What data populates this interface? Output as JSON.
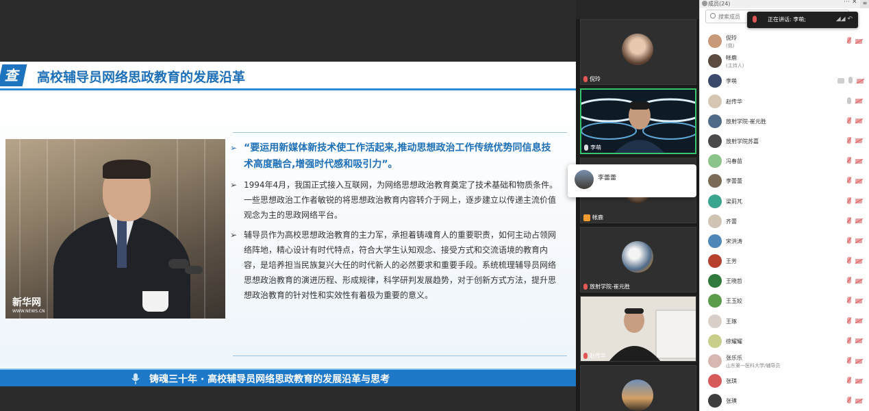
{
  "slide": {
    "logo_glyph": "查",
    "title": "高校辅导员网络思政教育的发展沿革",
    "photo_watermark": "新华网",
    "photo_watermark_sub": "WWW.NEWS.CN",
    "bullets": [
      "“要运用新媒体新技术使工作活起来,推动思想政治工作传统优势同信息技术高度融合,增强时代感和吸引力”。",
      "1994年4月，我国正式接入互联网，为网络思想政治教育奠定了技术基础和物质条件。一些思想政治工作者敏锐的将思想政治教育内容转介于网上，逐步建立以传递主流价值观念为主的思政网络平台。",
      "辅导员作为高校思想政治教育的主力军，承担着铸魂育人的重要职责，如何主动占领网络阵地，精心设计有时代特点，符合大学生认知观念、接受方式和交流语境的教育内容，是培养担当民族复兴大任的时代新人的必然要求和重要手段。系统梳理辅导员网络思想政治教育的演进历程、形成规律，科学研判发展趋势，对于创新方式方法，提升思想政治教育的针对性和实效性有着极为重要的意义。"
    ],
    "bullet_marker": "➢",
    "footer": "铸魂三十年 · 高校辅导员网络思政教育的发展沿革与思考",
    "footer_icon": "microphone-icon"
  },
  "gallery": {
    "tiles": [
      {
        "name": "倪玲",
        "mic": "muted"
      },
      {
        "name": "李萌",
        "mic": "on",
        "active": true
      },
      {
        "name": "帐鹿",
        "mic": "host"
      },
      {
        "name": "放射学院-崔元胜",
        "mic": "muted"
      },
      {
        "name": "赵传华",
        "mic": "muted"
      },
      {
        "name": "",
        "mic": "none"
      }
    ],
    "popup_name": "李蕾蕾"
  },
  "panel": {
    "title": "成员(24)",
    "more": "⋯",
    "close": "✕",
    "search_placeholder": "搜索成员",
    "speaking_label": "正在讲话: 李萌;",
    "members": [
      {
        "name": "倪玲",
        "sub": "(我)",
        "icons": [
          "mic-off",
          "cam-off"
        ],
        "color": "#c99a7a"
      },
      {
        "name": "帐鹿",
        "sub": "(主持人)",
        "icons": [],
        "color": "#5a4a40"
      },
      {
        "name": "李萌",
        "sub": "",
        "icons": [
          "chat",
          "mic-on",
          "cam-off"
        ],
        "color": "#3b4a6a"
      },
      {
        "name": "赵传华",
        "sub": "",
        "icons": [
          "mic-on",
          "cam-off"
        ],
        "color": "#d6c7b3"
      },
      {
        "name": "放射学院-崔元胜",
        "sub": "",
        "icons": [
          "mic-off",
          "cam-off"
        ],
        "color": "#4f6b88"
      },
      {
        "name": "放射学院苏嘉",
        "sub": "",
        "icons": [
          "mic-off",
          "cam-off"
        ],
        "color": "#4a4a4a"
      },
      {
        "name": "冯春苗",
        "sub": "",
        "icons": [
          "mic-off",
          "cam-off"
        ],
        "color": "#8bc48a"
      },
      {
        "name": "李蕾蕾",
        "sub": "",
        "icons": [
          "mic-off",
          "cam-off"
        ],
        "color": "#7b6a55"
      },
      {
        "name": "梁莉芃",
        "sub": "",
        "icons": [
          "mic-off",
          "cam-off"
        ],
        "color": "#3aa68f"
      },
      {
        "name": "齐蕾",
        "sub": "",
        "icons": [
          "mic-off",
          "cam-off"
        ],
        "color": "#cfc3b4"
      },
      {
        "name": "宋洪涛",
        "sub": "",
        "icons": [
          "mic-off",
          "cam-off"
        ],
        "color": "#4e86b8"
      },
      {
        "name": "王芳",
        "sub": "",
        "icons": [
          "mic-off",
          "cam-off"
        ],
        "color": "#b8412e"
      },
      {
        "name": "王晓哲",
        "sub": "",
        "icons": [
          "mic-off",
          "cam-off"
        ],
        "color": "#2f7a3c"
      },
      {
        "name": "王玉姣",
        "sub": "",
        "icons": [
          "mic-off",
          "cam-off"
        ],
        "color": "#5a9c4a"
      },
      {
        "name": "王琢",
        "sub": "",
        "icons": [
          "mic-off",
          "cam-off"
        ],
        "color": "#d8d0c8"
      },
      {
        "name": "徐耀耀",
        "sub": "",
        "icons": [
          "mic-off",
          "cam-off"
        ],
        "color": "#c9cf8a"
      },
      {
        "name": "张乐乐",
        "sub": "山东第一医科大学/辅导员",
        "icons": [
          "mic-off",
          "cam-off"
        ],
        "color": "#d7b7b2"
      },
      {
        "name": "张琪",
        "sub": "",
        "icons": [
          "mic-off",
          "cam-off"
        ],
        "color": "#d65a5a"
      },
      {
        "name": "张璜",
        "sub": "",
        "icons": [
          "mic-off",
          "cam-off"
        ],
        "color": "#3d3d3d"
      }
    ]
  }
}
